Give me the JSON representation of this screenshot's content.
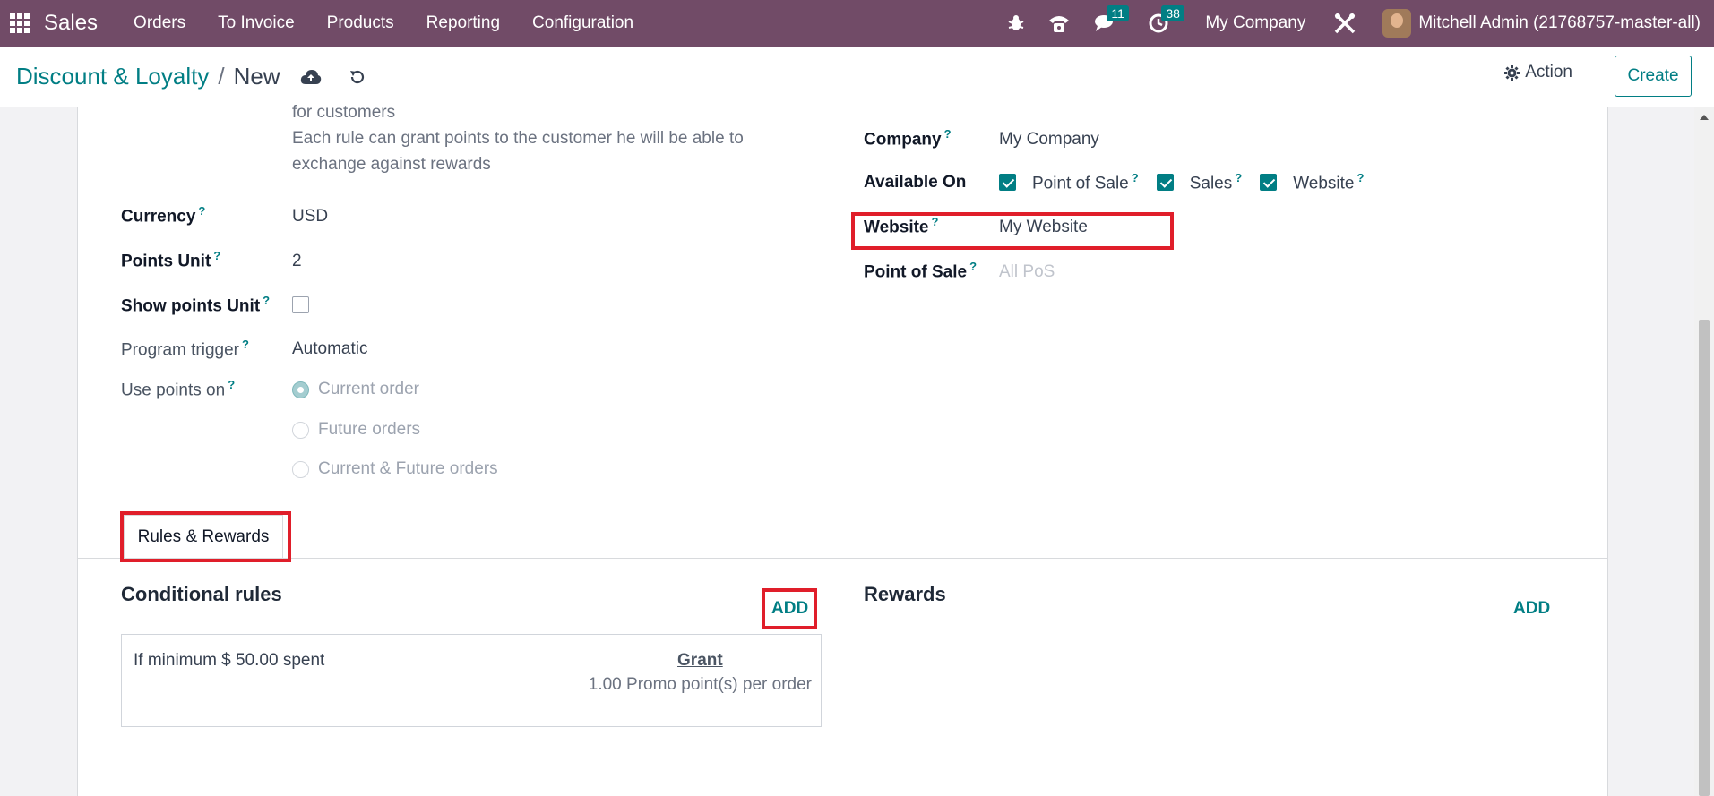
{
  "navbar": {
    "app_name": "Sales",
    "menu": [
      "Orders",
      "To Invoice",
      "Products",
      "Reporting",
      "Configuration"
    ],
    "messages_badge": "11",
    "activities_badge": "38",
    "company": "My Company",
    "user": "Mitchell Admin (21768757-master-all)",
    "bg_color": "#714b67"
  },
  "breadcrumb": {
    "parent": "Discount & Loyalty",
    "separator": "/",
    "current": "New"
  },
  "controls": {
    "action_label": "Action",
    "create_label": "Create"
  },
  "form": {
    "description_line0": "for customers",
    "description_line1": "Each rule can grant points to the customer he will be able to",
    "description_line2": "exchange against rewards",
    "currency": {
      "label": "Currency",
      "help": "?",
      "value": "USD"
    },
    "points_unit": {
      "label": "Points Unit",
      "help": "?",
      "value": "2"
    },
    "show_points_unit": {
      "label": "Show points Unit",
      "help": "?",
      "checked": false
    },
    "program_trigger": {
      "label": "Program trigger",
      "help": "?",
      "value": "Automatic"
    },
    "use_points_on": {
      "label": "Use points on",
      "help": "?",
      "options": [
        "Current order",
        "Future orders",
        "Current & Future orders"
      ],
      "selected": "Current order"
    },
    "company": {
      "label": "Company",
      "help": "?",
      "value": "My Company"
    },
    "available_on": {
      "label": "Available On",
      "options": [
        {
          "label": "Point of Sale",
          "help": "?",
          "checked": true
        },
        {
          "label": "Sales",
          "help": "?",
          "checked": true
        },
        {
          "label": "Website",
          "help": "?",
          "checked": true
        }
      ]
    },
    "website": {
      "label": "Website",
      "help": "?",
      "value": "My Website"
    },
    "point_of_sale": {
      "label": "Point of Sale",
      "help": "?",
      "placeholder": "All PoS"
    }
  },
  "tabs": {
    "active": "Rules & Rewards"
  },
  "rules_section": {
    "title": "Conditional rules",
    "add_label": "ADD",
    "rule": {
      "condition": "If minimum $ 50.00 spent",
      "grant_label": "Grant",
      "grant_value": "1.00 Promo point(s) per order"
    }
  },
  "rewards_section": {
    "title": "Rewards",
    "add_label": "ADD"
  },
  "colors": {
    "accent": "#017e84",
    "highlight": "#e01e2a"
  }
}
